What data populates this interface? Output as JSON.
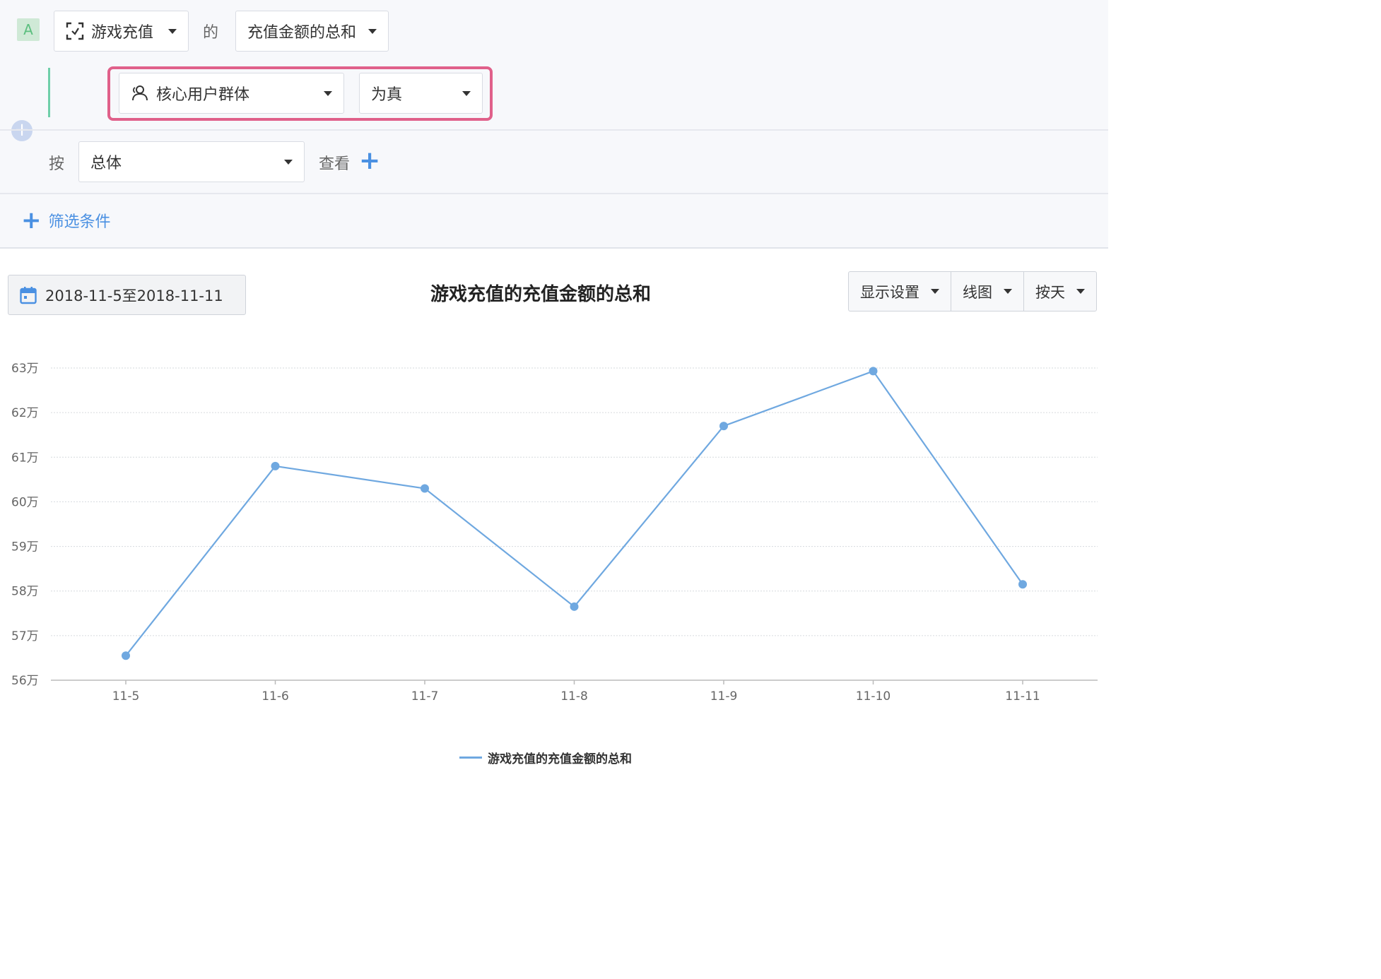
{
  "query": {
    "row_letter": "A",
    "event_select": "游戏充值",
    "of_text": "的",
    "metric_select": "充值金额的总和",
    "condition_field": "核心用户群体",
    "condition_op": "为真",
    "by_text": "按",
    "group_select": "总体",
    "view_text": "查看",
    "add_filter": "筛选条件"
  },
  "toolbar": {
    "date_range": "2018-11-5至2018-11-11",
    "display_settings": "显示设置",
    "chart_type": "线图",
    "granularity": "按天"
  },
  "colors": {
    "accent": "#4a90e2",
    "line": "#6fa8e0",
    "highlight": "#e0608a",
    "badge_text": "#5cbf7f"
  },
  "chart_data": {
    "type": "line",
    "title": "游戏充值的充值金额的总和",
    "categories": [
      "11-5",
      "11-6",
      "11-7",
      "11-8",
      "11-9",
      "11-10",
      "11-11"
    ],
    "series": [
      {
        "name": "游戏充值的充值金额的总和",
        "values": [
          565500,
          608000,
          603000,
          576500,
          617000,
          629300,
          581500
        ]
      }
    ],
    "ylim": [
      560000,
      630000
    ],
    "yticks": [
      "56万",
      "57万",
      "58万",
      "59万",
      "60万",
      "61万",
      "62万",
      "63万"
    ],
    "grid": true,
    "legend": "bottom-center"
  }
}
